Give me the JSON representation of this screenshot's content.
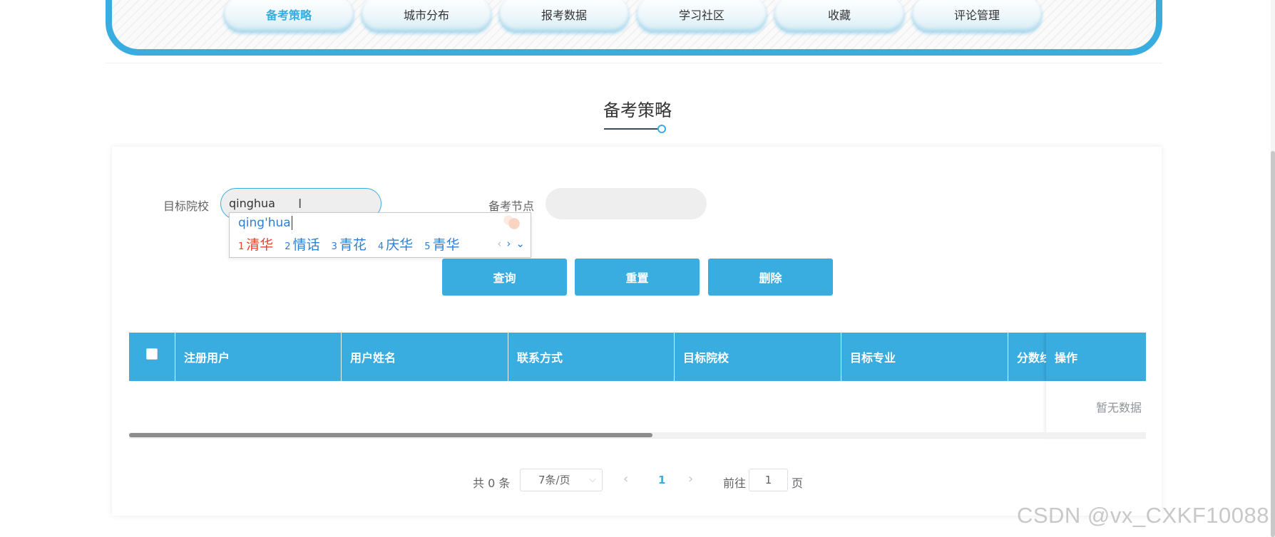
{
  "nav": {
    "tabs": [
      {
        "label": "备考策略",
        "active": true
      },
      {
        "label": "城市分布"
      },
      {
        "label": "报考数据"
      },
      {
        "label": "学习社区"
      },
      {
        "label": "收藏"
      },
      {
        "label": "评论管理"
      }
    ]
  },
  "page_title": "备考策略",
  "search": {
    "school_label": "目标院校",
    "school_value": "qinghua",
    "node_label": "备考节点",
    "node_value": ""
  },
  "ime": {
    "composition": "qing'hua",
    "candidates": [
      {
        "n": "1",
        "text": "清华"
      },
      {
        "n": "2",
        "text": "情话"
      },
      {
        "n": "3",
        "text": "青花"
      },
      {
        "n": "4",
        "text": "庆华"
      },
      {
        "n": "5",
        "text": "青华"
      }
    ],
    "prev_icon": "‹",
    "next_icon": "›",
    "expand_icon": "⌄"
  },
  "buttons": {
    "query": "查询",
    "reset": "重置",
    "delete": "删除"
  },
  "table": {
    "columns": [
      "注册用户",
      "用户姓名",
      "联系方式",
      "目标院校",
      "目标专业",
      "分数线"
    ],
    "operation_column": "操作",
    "empty_text": "暂无数据"
  },
  "pagination": {
    "total": "共 0 条",
    "page_size": "7条/页",
    "current_page": "1",
    "goto_label": "前往",
    "goto_value": "1",
    "page_suffix": "页"
  },
  "watermark": "CSDN @vx_CXKF10088",
  "colors": {
    "accent": "#39ace0",
    "ime_first": "#e0452c",
    "ime_text": "#2f7fd1"
  }
}
